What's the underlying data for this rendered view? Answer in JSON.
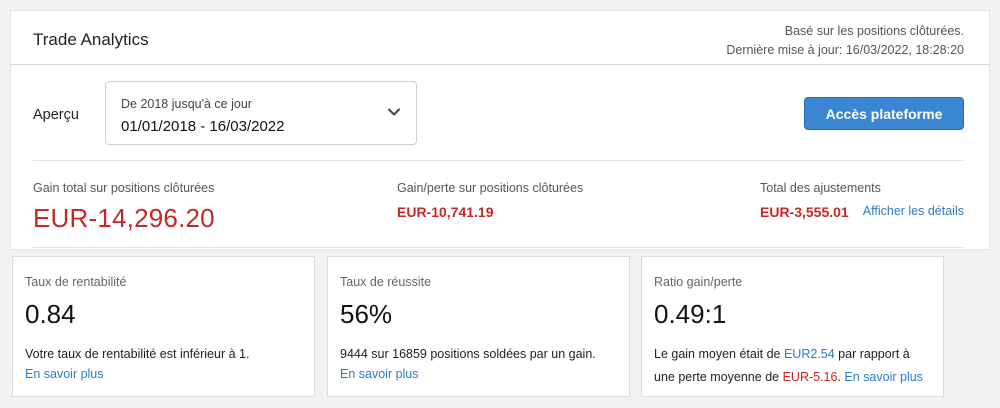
{
  "header": {
    "title": "Trade Analytics",
    "based_on": "Basé sur les positions clôturées.",
    "last_update": "Dernière mise à jour: 16/03/2022, 18:28:20"
  },
  "overview": {
    "label": "Aperçu",
    "range_caption": "De 2018 jusqu'à ce jour",
    "range_value": "01/01/2018 - 16/03/2022",
    "platform_button": "Accès plateforme"
  },
  "stats": {
    "total_label": "Gain total sur positions clôturées",
    "total_value": "EUR-14,296.20",
    "pl_label": "Gain/perte sur positions clôturées",
    "pl_value": "EUR-10,741.19",
    "adjust_label": "Total des ajustements",
    "adjust_value": "EUR-3,555.01",
    "details_link": "Afficher les détails"
  },
  "cards": {
    "profitability": {
      "label": "Taux de rentabilité",
      "value": "0.84",
      "description": "Votre taux de rentabilité est inférieur à 1.",
      "link": "En savoir plus"
    },
    "success": {
      "label": "Taux de réussite",
      "value": "56%",
      "description": "9444 sur 16859 positions soldées par un gain.",
      "link": "En savoir plus"
    },
    "ratio": {
      "label": "Ratio gain/perte",
      "value": "0.49:1",
      "desc_part1": "Le gain moyen était de ",
      "avg_gain": "EUR2.54",
      "desc_part2": " par rapport à",
      "desc_part3": "une perte moyenne de ",
      "avg_loss": "EUR-5.16",
      "desc_part4": ". ",
      "link": "En savoir plus"
    }
  },
  "colors": {
    "accent": "#3a86d2",
    "loss": "#c62828",
    "link": "#2b7bc9"
  }
}
